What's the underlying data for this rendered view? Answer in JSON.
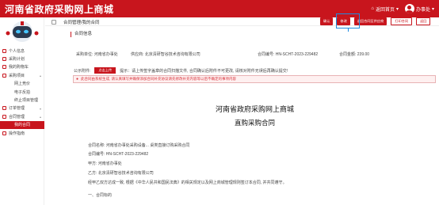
{
  "app": {
    "title": "河南省政府采购网上商城"
  },
  "topbar": {
    "home_label": "返回首页",
    "user_name": "办事处"
  },
  "sidebar": {
    "items": [
      {
        "label": "个人信息",
        "type": "parent"
      },
      {
        "label": "采购计划",
        "type": "parent"
      },
      {
        "label": "我的购物车",
        "type": "parent"
      },
      {
        "label": "采购项目",
        "type": "parent"
      },
      {
        "label": "网上竞价",
        "type": "sub"
      },
      {
        "label": "电子反拍",
        "type": "sub"
      },
      {
        "label": "终止项目管理",
        "type": "sub"
      },
      {
        "label": "订单管理",
        "type": "parent"
      },
      {
        "label": "合同管理",
        "type": "parent"
      },
      {
        "label": "我的合同",
        "type": "selected"
      },
      {
        "label": "操作指南",
        "type": "parent"
      }
    ]
  },
  "breadcrumb": "合同管理/我的合同",
  "toolbar": {
    "confirm_label": "确认",
    "modify_label": "修改",
    "return_label": "退回合同至供应商",
    "print_label": "打印合同",
    "back_label": "返回"
  },
  "contract": {
    "section_title": "合同信息",
    "buyer": "采购单位: 河南省办事处",
    "supplier": "供应商: 北京清研智谷技术咨询有限公司",
    "number": "合同编号: HN-SCHT-2023-229482",
    "amount": "合同金额: 239.00",
    "attachment_label": "公示附件:",
    "upload_label": "点击上传",
    "hint": "提示：请上传签字盖章的合同扫描文件, 合同确认后附件不可更改, 请核对附件无误后再确认提交!",
    "alert": "此合同由系统生成, 请认真填写并确保添加合同补充协议请先修改补充内容等以后不确定的事项内容"
  },
  "document": {
    "title": "河南省政府采购网上商城",
    "subtitle": "直购采购合同",
    "lines": [
      "合同名称: 河南省办事处采购设备... 桌类直接订购采购合同",
      "合同编号: HN-SCHT-2023-229482",
      "甲方: 河南省办事处",
      "乙方: 北京清研智谷技术咨询有限公司",
      "经甲乙双方达成一致, 根据《中华人民共和国民法典》的相关规定以及网上商城管理规则签订本合同, 并共同遵守。",
      "一、合同标的"
    ]
  },
  "colors": {
    "brand": "#c8151d",
    "highlight": "#1f8be0"
  }
}
